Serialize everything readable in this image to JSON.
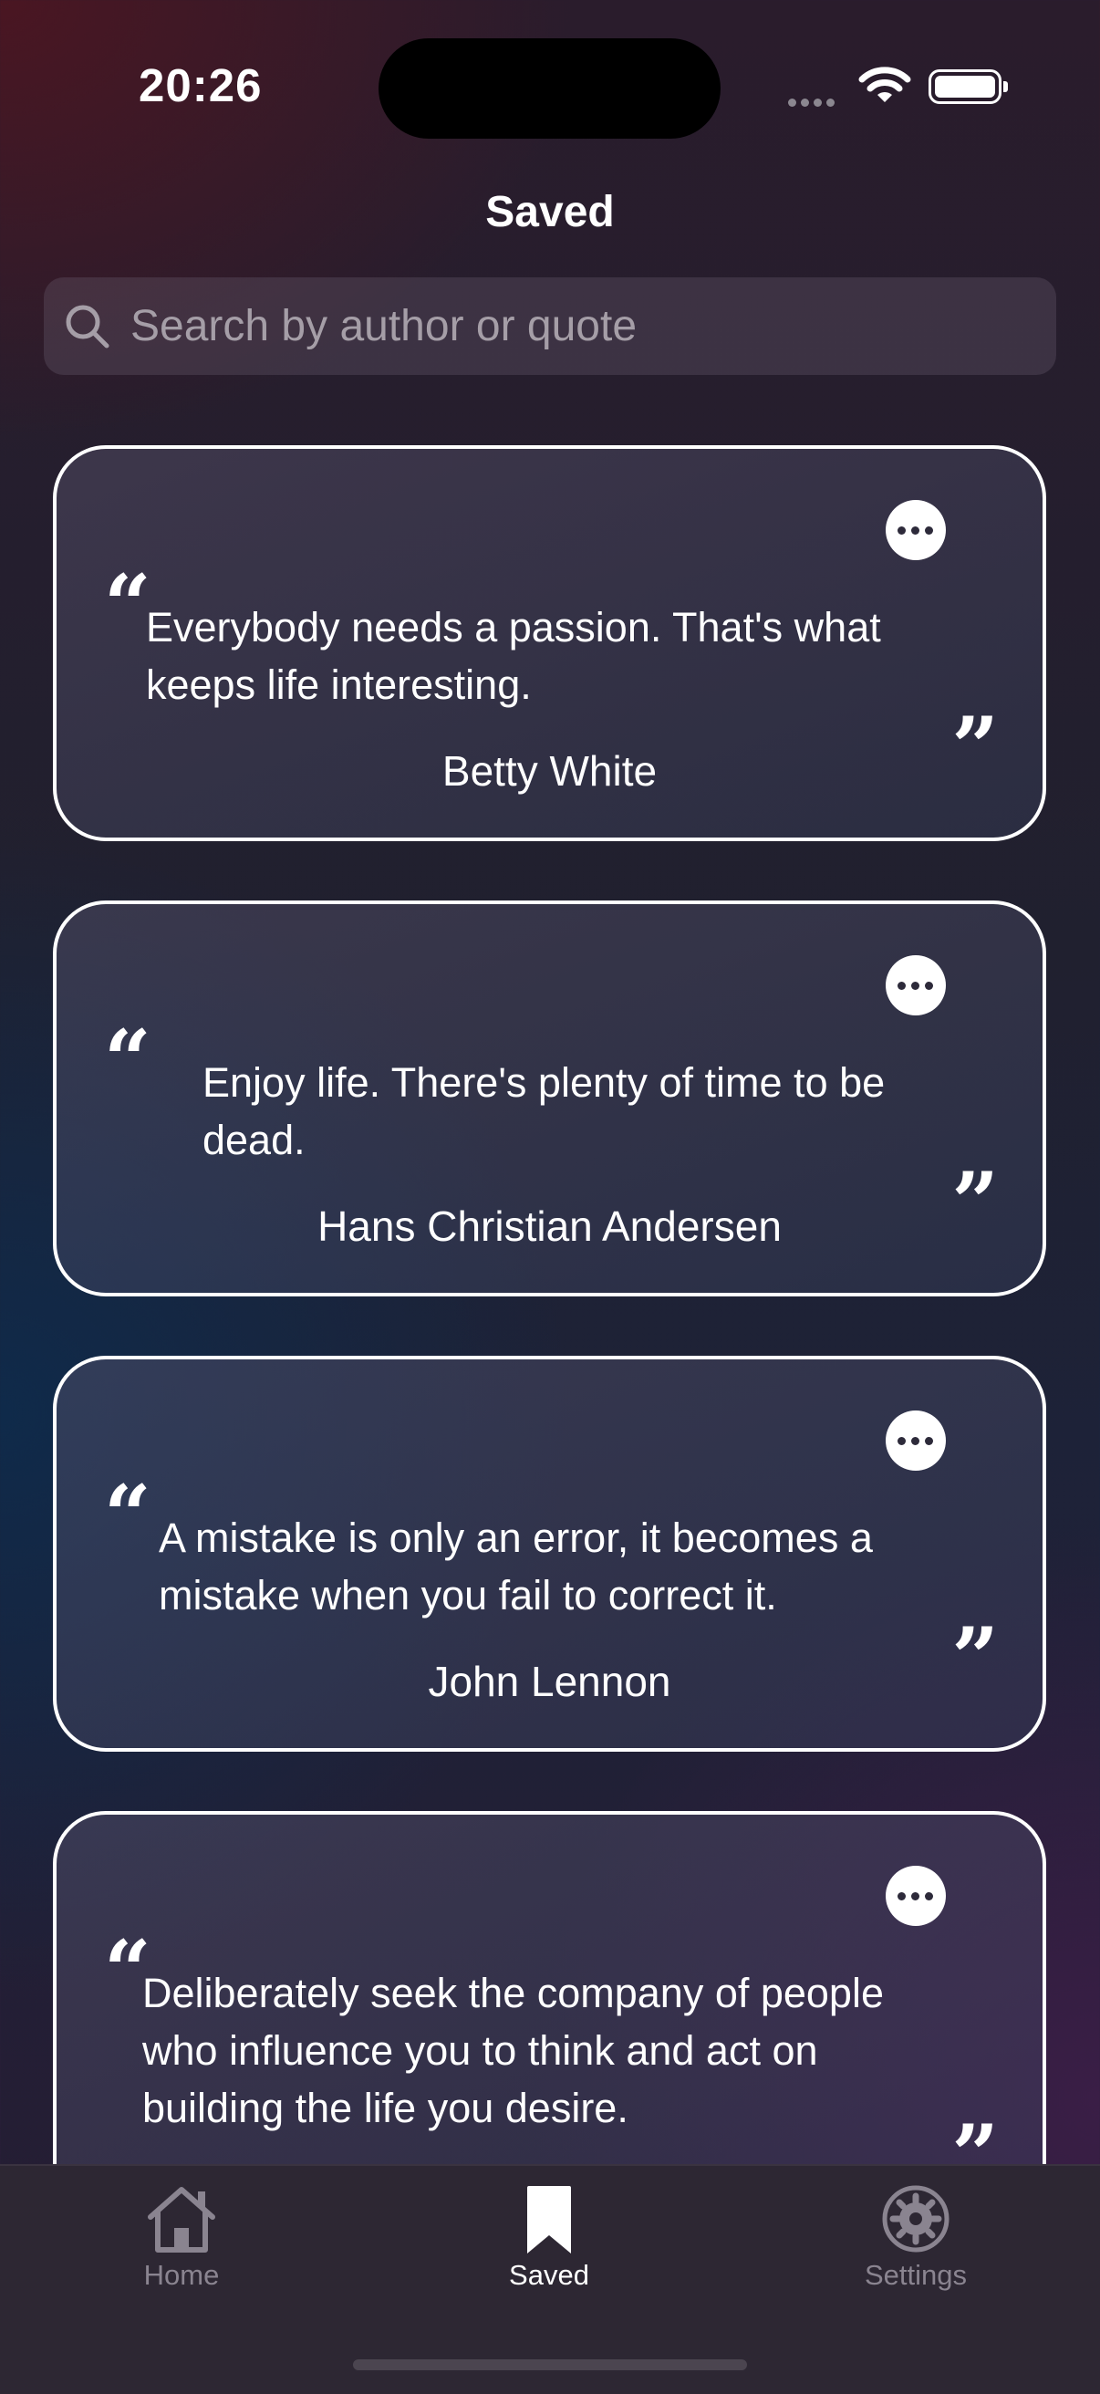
{
  "status_bar": {
    "time": "20:26"
  },
  "header": {
    "title": "Saved"
  },
  "search": {
    "placeholder": "Search by author or quote"
  },
  "quotes": [
    {
      "text": "Everybody needs a passion. That's what keeps life interesting.",
      "author": "Betty White"
    },
    {
      "text": "Enjoy life. There's plenty of time to be dead.",
      "author": "Hans Christian Andersen"
    },
    {
      "text": "A mistake is only an error, it becomes a mistake when you fail to correct it.",
      "author": "John Lennon"
    },
    {
      "text": "Deliberately seek the company of people who influence you to think and act on building the life you desire.",
      "author": ""
    }
  ],
  "tabs": [
    {
      "label": "Home",
      "icon": "home-icon"
    },
    {
      "label": "Saved",
      "icon": "bookmark-icon"
    },
    {
      "label": "Settings",
      "icon": "gear-icon"
    }
  ],
  "colors": {
    "active_tab": "#ffffff",
    "inactive_tab": "#8a8490"
  }
}
